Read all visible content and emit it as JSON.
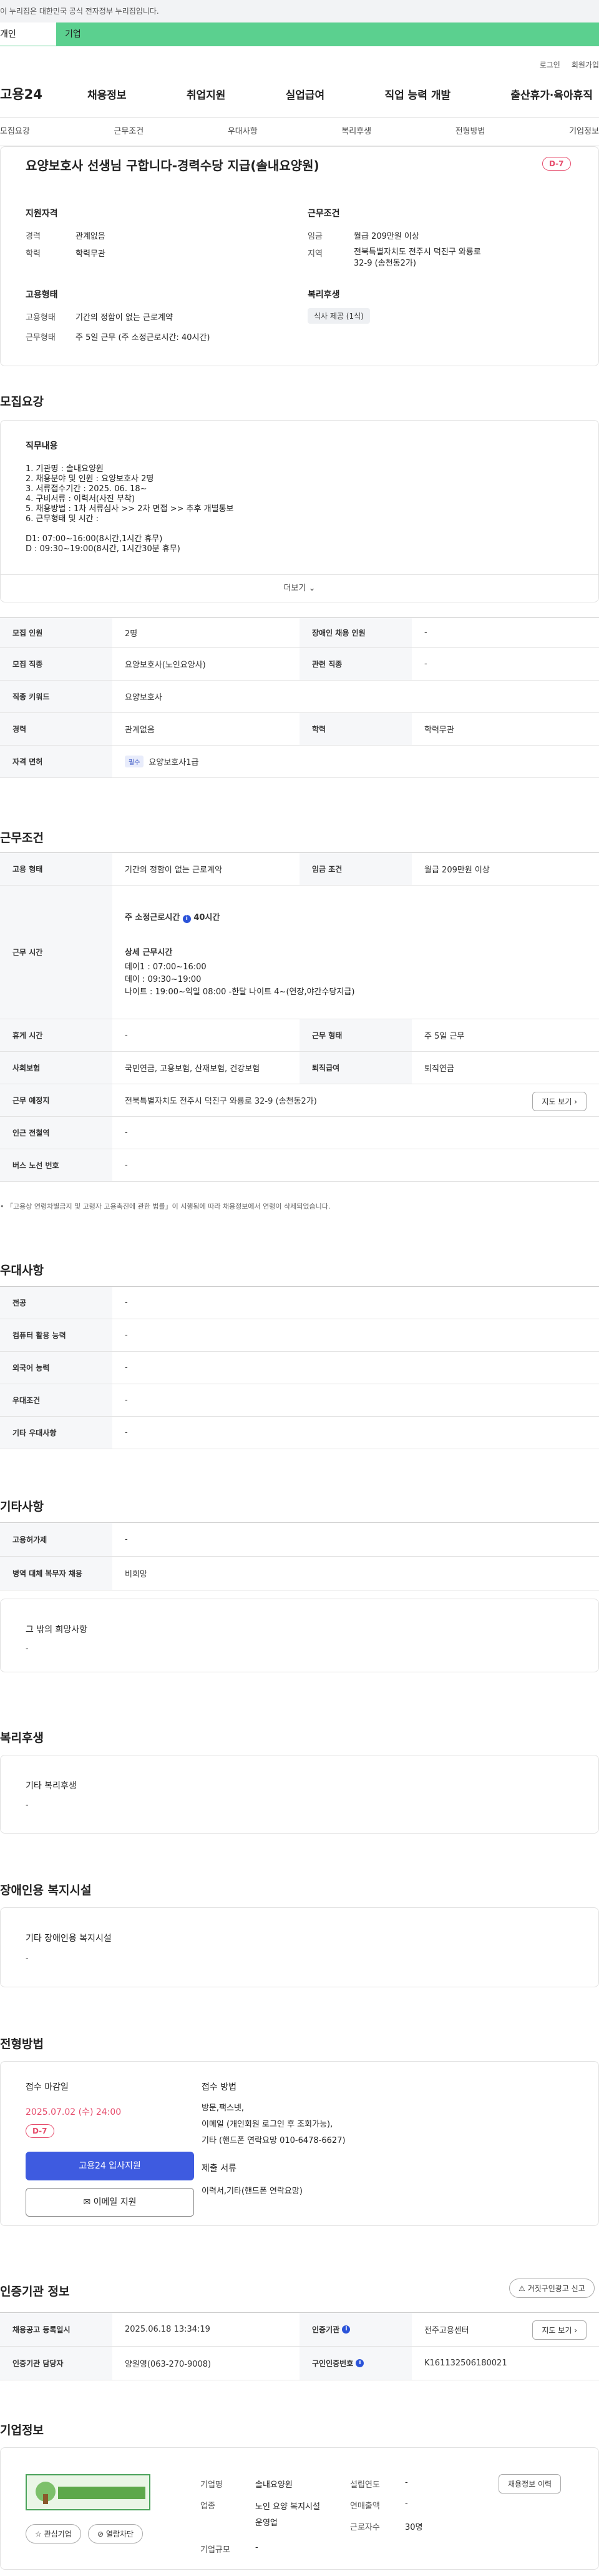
{
  "gov_bar": "이 누리집은 대한민국 공식 전자정부 누리집입니다.",
  "role_tabs": [
    "개인",
    "기업"
  ],
  "util": [
    "로그인",
    "회원가입"
  ],
  "logo": "고용24",
  "gnb": [
    "채용정보",
    "취업지원",
    "실업급여",
    "직업 능력 개발",
    "출산휴가·육아휴직"
  ],
  "anchor": [
    "모집요강",
    "근무조건",
    "우대사항",
    "복리후생",
    "전형방법",
    "기업정보"
  ],
  "title": "요양보호사 선생님 구합니다-경력수당 지급(솔내요양원)",
  "dday": "D-7",
  "summary": {
    "qual_h": "지원자격",
    "cond_h": "근무조건",
    "emp_h": "고용형태",
    "welfare_h": "복리후생",
    "career_k": "경력",
    "career_v": "관계없음",
    "edu_k": "학력",
    "edu_v": "학력무관",
    "wage_k": "임금",
    "wage_v": "월급 209만원 이상",
    "area_k": "지역",
    "area_v": "전북특별자치도 전주시 덕진구 와룡로 32-9 (송천동2가)",
    "etype_k": "고용형태",
    "etype_v": "기간의 정함이 없는 근로계약",
    "wtype_k": "근무형태",
    "wtype_v": "주 5일 근무 (주 소정근로시간: 40시간)",
    "welfare_tag": "식사 제공 (1식)"
  },
  "recruit": {
    "title": "모집요강",
    "job_h": "직무내용",
    "job_text": "1. 기관명 : 솔내요양원\n2. 채용분야 및 인원 : 요양보호사 2명\n3. 서류접수기간 : 2025. 06. 18~\n4. 구비서류 : 이력서(사진 부착)\n5. 채용방법 : 1차 서류심사 >> 2차 면접 >>  추후 개별통보\n6. 근무형태 및 시간 :\n\n   D1: 07:00~16:00(8시간,1시간 휴무)\n   D : 09:30~19:00(8시간, 1시간30분 휴무)",
    "more": "더보기",
    "rows": [
      [
        "모집 인원",
        "2명",
        "장애인 채용 인원",
        "-"
      ],
      [
        "모집 직종",
        "요양보호사(노인요양사)",
        "관련 직종",
        "-"
      ],
      [
        "직종 키워드",
        "요양보호사",
        "",
        ""
      ],
      [
        "경력",
        "관계없음",
        "학력",
        "학력무관"
      ]
    ],
    "license_k": "자격 면허",
    "license_tag": "필수",
    "license_v": "요양보호사1급"
  },
  "work": {
    "title": "근무조건",
    "etype_k": "고용 형태",
    "etype_v": "기간의 정함이 없는 근로계약",
    "wage_k": "임금 조건",
    "wage_v": "월급 209만원 이상",
    "time_k": "근무 시간",
    "time_total": "주 소정근로시간",
    "time_total_v": "40시간",
    "detail_h": "상세 근무시간",
    "detail": "데이1 :  07:00~16:00\n데이   :  09:30~19:00\n나이트 :  19:00~익일 08:00  -한달 나이트 4~(연장,야간수당지급)",
    "rest_k": "휴게 시간",
    "rest_v": "-",
    "form_k": "근무 형태",
    "form_v": "주 5일 근무",
    "ins_k": "사회보험",
    "ins_v": "국민연금, 고용보험, 산재보험, 건강보험",
    "ret_k": "퇴직급여",
    "ret_v": "퇴직연금",
    "place_k": "근무 예정지",
    "place_v": "전북특별자치도 전주시 덕진구 와룡로 32-9 (송천동2가)",
    "map_btn": "지도 보기",
    "sub_k": "인근 전철역",
    "sub_v": "-",
    "bus_k": "버스 노선 번호",
    "bus_v": "-",
    "note": "「고용상 연령차별금지 및 고령자 고용촉진에 관한 법률」이 시행됨에 따라 채용정보에서 연령이 삭제되었습니다."
  },
  "pref": {
    "title": "우대사항",
    "rows": [
      [
        "전공",
        "-"
      ],
      [
        "컴퓨터 활용 능력",
        "-"
      ],
      [
        "외국어 능력",
        "-"
      ],
      [
        "우대조건",
        "-"
      ],
      [
        "기타 우대사항",
        "-"
      ]
    ]
  },
  "etc": {
    "title": "기타사항",
    "rows": [
      [
        "고용허가제",
        "-"
      ],
      [
        "병역 대체 복무자 채용",
        "비희망"
      ]
    ],
    "hope_h": "그 밖의 희망사항",
    "hope_v": "-"
  },
  "welfare": {
    "title": "복리후생",
    "h": "기타 복리후생",
    "v": "-"
  },
  "disab": {
    "title": "장애인용 복지시설",
    "h": "기타 장애인용 복지시설",
    "v": "-"
  },
  "apply": {
    "title": "전형방법",
    "deadline_h": "접수 마감일",
    "deadline_v": "2025.07.02 (수) 24:00",
    "dday": "D-7",
    "btn1": "고용24 입사지원",
    "btn2": "이메일 지원",
    "method_h": "접수 방법",
    "method_v": "방문,팩스넷,\n이메일 (개인회원 로그인 후 조회가능),\n기타 (핸드폰 연락요망  010-6478-6627)",
    "doc_h": "제출 서류",
    "doc_v": "이력서,기타(핸드폰 연락요망)"
  },
  "cert": {
    "title": "인증기관 정보",
    "report_btn": "거짓구인광고 신고",
    "reg_k": "채용공고 등록일시",
    "reg_v": "2025.06.18 13:34:19",
    "org_k": "인증기관",
    "org_v": "전주고용센터",
    "map_btn": "지도 보기",
    "mgr_k": "인증기관 담당자",
    "mgr_v": "양원영(063-270-9008)",
    "no_k": "구인인증번호",
    "no_v": "K161132506180021"
  },
  "company": {
    "title": "기업정보",
    "logo_text": "솔내요양원",
    "fav": "관심기업",
    "block": "열람차단",
    "jobs_btn": "채용정보 이력",
    "name_k": "기업명",
    "name_v": "솔내요양원",
    "year_k": "설립연도",
    "year_v": "-",
    "ind_k": "업종",
    "ind_v": "노인 요양 복지시설 운영업",
    "sales_k": "연매출액",
    "sales_v": "-",
    "emp_k": "근로자수",
    "emp_v": "30명",
    "size_k": "기업규모",
    "size_v": "-"
  },
  "colors": {
    "accent": "#5bd08f",
    "dday": "#e64b6b",
    "primary_btn": "#3e5be0"
  }
}
